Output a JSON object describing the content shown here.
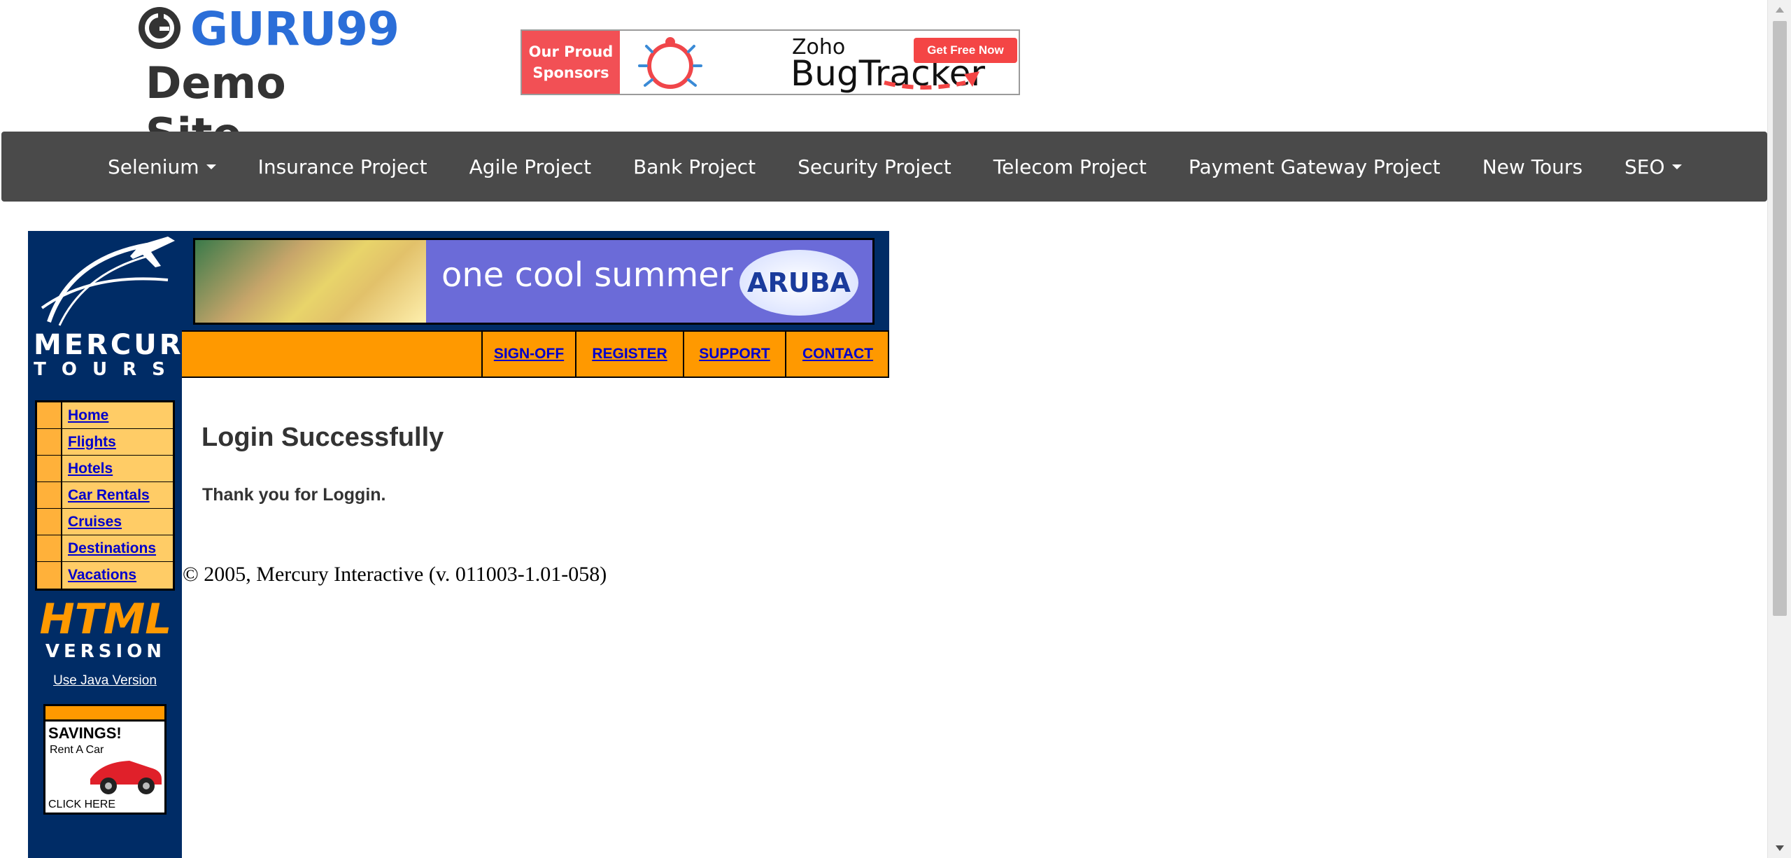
{
  "header": {
    "logo_text": "GURU99",
    "demo_text": "Demo Site"
  },
  "sponsor": {
    "line1": "Our Proud",
    "line2": "Sponsors",
    "zoho": "Zoho",
    "product": "BugTracker",
    "cta": "Get Free Now"
  },
  "nav": {
    "items": [
      {
        "label": "Selenium",
        "dropdown": true
      },
      {
        "label": "Insurance Project"
      },
      {
        "label": "Agile Project"
      },
      {
        "label": "Bank Project"
      },
      {
        "label": "Security Project"
      },
      {
        "label": "Telecom Project"
      },
      {
        "label": "Payment Gateway Project"
      },
      {
        "label": "New Tours"
      },
      {
        "label": "SEO",
        "dropdown": true
      }
    ]
  },
  "mercury": {
    "brand": "MERCURY",
    "tours": "TOURS",
    "banner_text": "one cool summer",
    "banner_brand": "ARUBA",
    "top_links": [
      "SIGN-OFF",
      "REGISTER",
      "SUPPORT",
      "CONTACT"
    ],
    "side_links": [
      "Home",
      "Flights",
      "Hotels",
      "Car Rentals",
      "Cruises",
      "Destinations",
      "Vacations"
    ],
    "html_word": "HTML",
    "version_word": "VERSION",
    "java_link": "Use Java Version",
    "savings_title": "SAVINGS!",
    "savings_sub": "Rent A Car",
    "savings_click": "CLICK HERE"
  },
  "content": {
    "title": "Login Successfully",
    "message": "Thank you for Loggin.",
    "copyright": "© 2005, Mercury Interactive (v. 011003-1.01-058)"
  },
  "colors": {
    "guru_blue": "#2b6ed8",
    "nav_bg": "#4a4a4a",
    "mercury_navy": "#002c66",
    "mercury_orange": "#ff9900",
    "side_link_bg": "#ffcc66",
    "link_blue": "#0000cc"
  }
}
